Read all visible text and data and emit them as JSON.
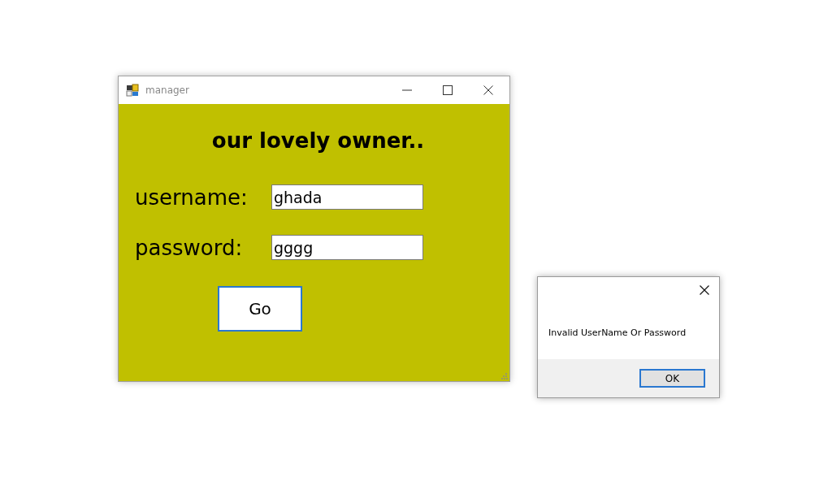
{
  "window": {
    "title": "manager"
  },
  "heading": "our lovely owner..",
  "fields": [
    {
      "label": "username:",
      "value": "ghada"
    },
    {
      "label": "password:",
      "value": "gggg"
    }
  ],
  "go_button": "Go",
  "dialog": {
    "message": "Invalid UserName Or Password",
    "button": "OK"
  }
}
